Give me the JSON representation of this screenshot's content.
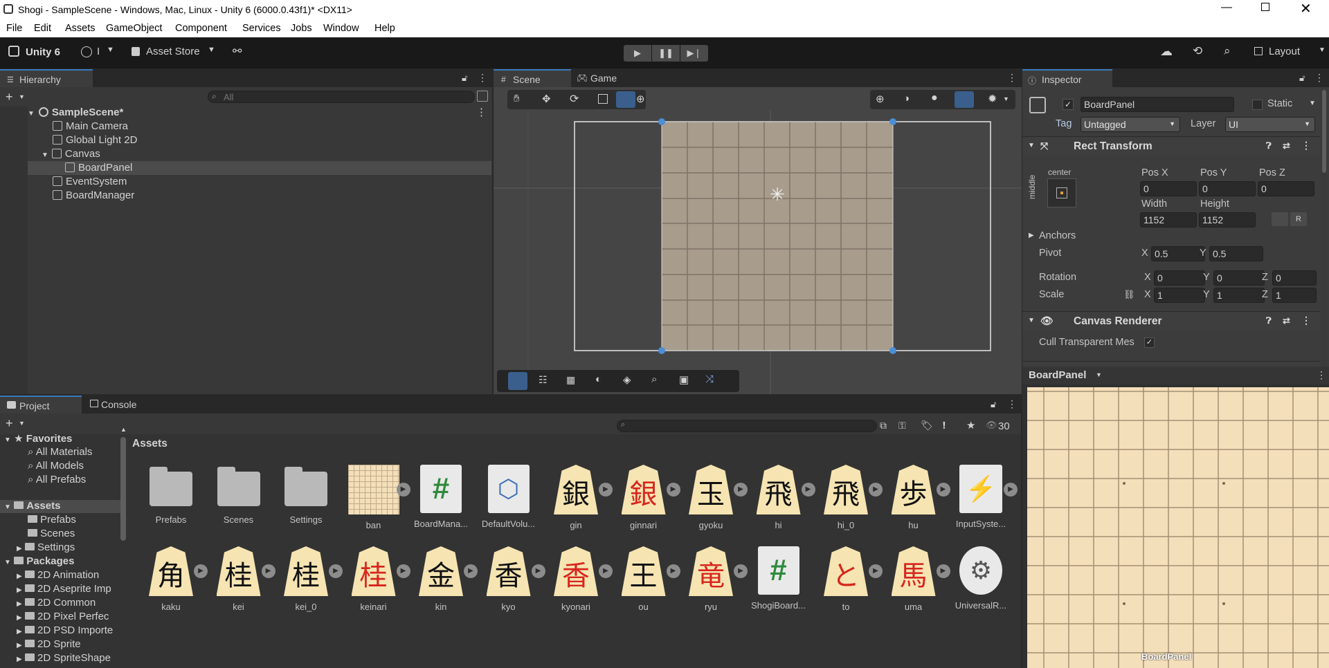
{
  "window": {
    "title": "Shogi - SampleScene - Windows, Mac, Linux - Unity 6 (6000.0.43f1)* <DX11>"
  },
  "menu": [
    "File",
    "Edit",
    "Assets",
    "GameObject",
    "Component",
    "Services",
    "Jobs",
    "Window",
    "Help"
  ],
  "toolbar": {
    "unity_label": "Unity 6",
    "account_label": "I",
    "asset_store": "Asset Store",
    "layout": "Layout"
  },
  "hierarchy": {
    "tab": "Hierarchy",
    "search_placeholder": "All",
    "items": [
      {
        "label": "SampleScene*",
        "depth": 0
      },
      {
        "label": "Main Camera",
        "depth": 1
      },
      {
        "label": "Global Light 2D",
        "depth": 1
      },
      {
        "label": "Canvas",
        "depth": 1
      },
      {
        "label": "BoardPanel",
        "depth": 2
      },
      {
        "label": "EventSystem",
        "depth": 1
      },
      {
        "label": "BoardManager",
        "depth": 1
      }
    ]
  },
  "scene": {
    "tabs": [
      "Scene",
      "Game"
    ]
  },
  "inspector": {
    "tab": "Inspector",
    "object_name": "BoardPanel",
    "static": "Static",
    "tag_label": "Tag",
    "tag": "Untagged",
    "layer_label": "Layer",
    "layer": "UI",
    "rect_transform": "Rect Transform",
    "anchor_h": "center",
    "anchor_v": "middle",
    "pos_x_label": "Pos X",
    "pos_y_label": "Pos Y",
    "pos_z_label": "Pos Z",
    "pos_x": "0",
    "pos_y": "0",
    "pos_z": "0",
    "width_label": "Width",
    "height_label": "Height",
    "width": "1152",
    "height": "1152",
    "anchors": "Anchors",
    "pivot": "Pivot",
    "pivot_x": "0.5",
    "pivot_y": "0.5",
    "rotation": "Rotation",
    "rot_x": "0",
    "rot_y": "0",
    "rot_z": "0",
    "scale": "Scale",
    "scale_x": "1",
    "scale_y": "1",
    "scale_z": "1",
    "canvas_renderer": "Canvas Renderer",
    "cull": "Cull Transparent Mes",
    "preview_title": "BoardPanel",
    "preview_caption": "BoardPanel"
  },
  "project": {
    "tabs": [
      "Project",
      "Console"
    ],
    "breadcrumb": "Assets",
    "count": "30",
    "tree": [
      {
        "label": "Favorites",
        "depth": 0
      },
      {
        "label": "All Materials",
        "depth": 1
      },
      {
        "label": "All Models",
        "depth": 1
      },
      {
        "label": "All Prefabs",
        "depth": 1
      },
      {
        "label": "Assets",
        "depth": 0
      },
      {
        "label": "Prefabs",
        "depth": 1
      },
      {
        "label": "Scenes",
        "depth": 1
      },
      {
        "label": "Settings",
        "depth": 1
      },
      {
        "label": "Packages",
        "depth": 0
      },
      {
        "label": "2D Animation",
        "depth": 1
      },
      {
        "label": "2D Aseprite Imp",
        "depth": 1
      },
      {
        "label": "2D Common",
        "depth": 1
      },
      {
        "label": "2D Pixel Perfec",
        "depth": 1
      },
      {
        "label": "2D PSD Importe",
        "depth": 1
      },
      {
        "label": "2D Sprite",
        "depth": 1
      },
      {
        "label": "2D SpriteShape",
        "depth": 1
      }
    ],
    "assets_row1": [
      {
        "label": "Prefabs",
        "kind": "folder"
      },
      {
        "label": "Scenes",
        "kind": "folder"
      },
      {
        "label": "Settings",
        "kind": "folder"
      },
      {
        "label": "ban",
        "kind": "grid"
      },
      {
        "label": "BoardMana...",
        "kind": "script"
      },
      {
        "label": "DefaultVolu...",
        "kind": "volume"
      },
      {
        "label": "gin",
        "kind": "piece",
        "glyph": "銀",
        "red": false
      },
      {
        "label": "ginnari",
        "kind": "piece",
        "glyph": "銀",
        "red": true
      },
      {
        "label": "gyoku",
        "kind": "piece",
        "glyph": "玉",
        "red": false
      },
      {
        "label": "hi",
        "kind": "piece",
        "glyph": "飛",
        "red": false
      },
      {
        "label": "hi_0",
        "kind": "piece",
        "glyph": "飛",
        "red": false
      },
      {
        "label": "hu",
        "kind": "piece",
        "glyph": "歩",
        "red": false
      },
      {
        "label": "InputSyste...",
        "kind": "input"
      }
    ],
    "assets_row2": [
      {
        "label": "kaku",
        "kind": "piece",
        "glyph": "角",
        "red": false
      },
      {
        "label": "kei",
        "kind": "piece",
        "glyph": "桂",
        "red": false
      },
      {
        "label": "kei_0",
        "kind": "piece",
        "glyph": "桂",
        "red": false
      },
      {
        "label": "keinari",
        "kind": "piece",
        "glyph": "桂",
        "red": true
      },
      {
        "label": "kin",
        "kind": "piece",
        "glyph": "金",
        "red": false
      },
      {
        "label": "kyo",
        "kind": "piece",
        "glyph": "香",
        "red": false
      },
      {
        "label": "kyonari",
        "kind": "piece",
        "glyph": "香",
        "red": true
      },
      {
        "label": "ou",
        "kind": "piece",
        "glyph": "王",
        "red": false
      },
      {
        "label": "ryu",
        "kind": "piece",
        "glyph": "竜",
        "red": true
      },
      {
        "label": "ShogiBoard...",
        "kind": "script"
      },
      {
        "label": "to",
        "kind": "piece",
        "glyph": "と",
        "red": true
      },
      {
        "label": "uma",
        "kind": "piece",
        "glyph": "馬",
        "red": true
      },
      {
        "label": "UniversalR...",
        "kind": "urp"
      }
    ]
  }
}
